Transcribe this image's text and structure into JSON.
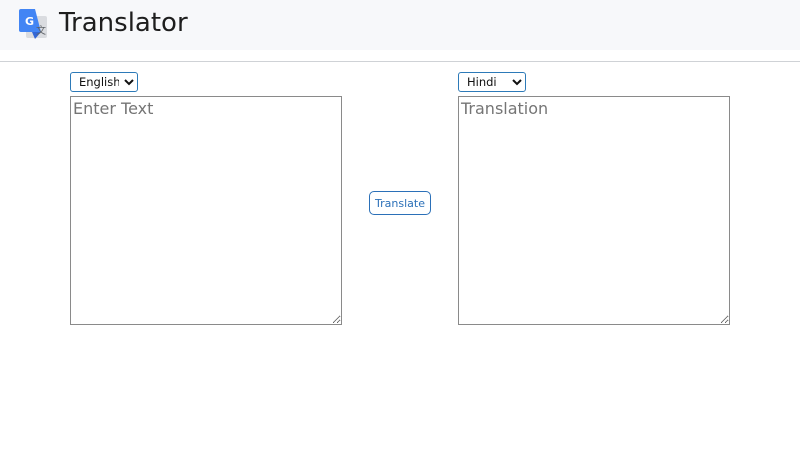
{
  "app": {
    "title": "Translator",
    "logo_icon": "google-translate-icon",
    "logo_letter": "G",
    "logo_glyph": "文"
  },
  "source": {
    "language": "English",
    "placeholder": "Enter Text",
    "value": ""
  },
  "target": {
    "language": "Hindi",
    "placeholder": "Translation",
    "value": ""
  },
  "actions": {
    "translate_label": "Translate"
  },
  "colors": {
    "header_bg": "#f7f8fa",
    "accent": "#2b70b8",
    "logo_blue": "#4285f4",
    "logo_gray": "#dadce0"
  }
}
